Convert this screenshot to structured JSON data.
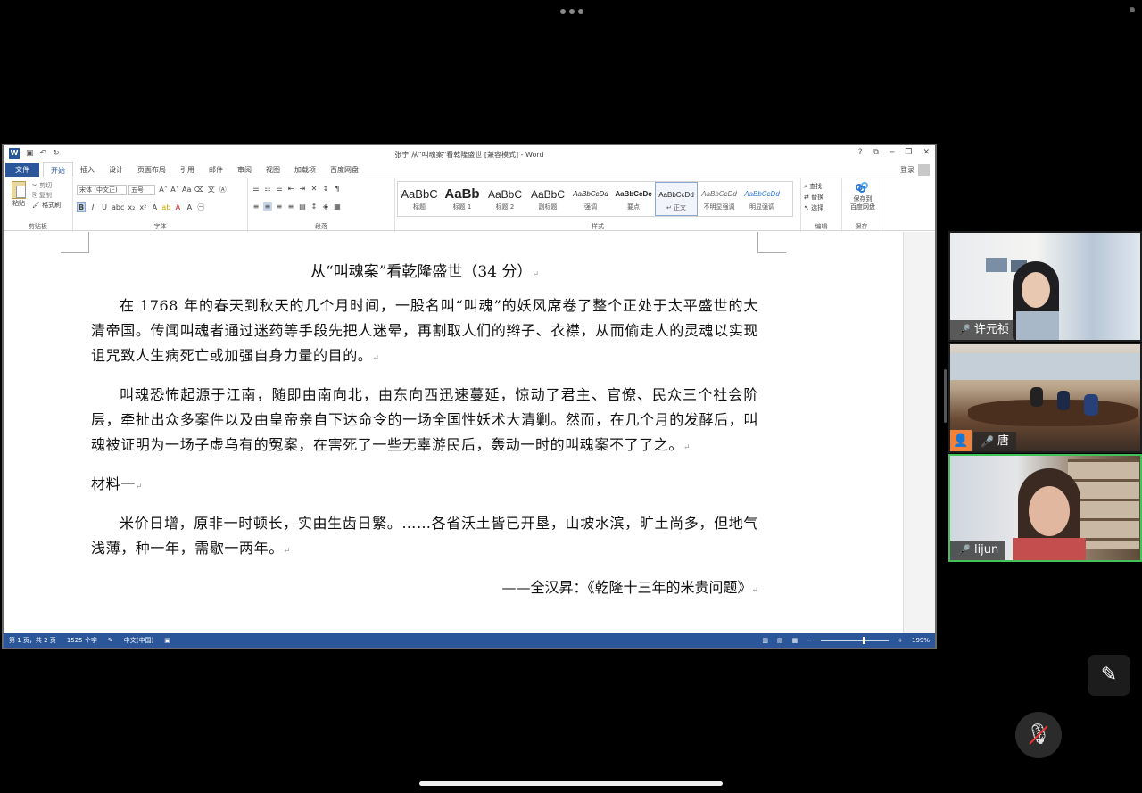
{
  "word": {
    "window_title": "张宁 从\"叫魂案\"看乾隆盛世 [兼容模式] - Word",
    "file_tab": "文件",
    "tabs": [
      "开始",
      "插入",
      "设计",
      "页面布局",
      "引用",
      "邮件",
      "审阅",
      "视图",
      "加载项",
      "百度网盘"
    ],
    "login": "登录",
    "window_controls": [
      "?",
      "⧉",
      "─",
      "❐",
      "✕"
    ],
    "ribbon": {
      "clipboard": {
        "paste": "粘贴",
        "cut": "剪切",
        "copy": "复制",
        "format_painter": "格式刷",
        "label": "剪贴板"
      },
      "font": {
        "name": "宋体 (中文正)",
        "size": "五号",
        "label": "字体"
      },
      "paragraph": {
        "label": "段落"
      },
      "styles": {
        "label": "样式",
        "items": [
          {
            "sample": "AaBbC",
            "name": "标题"
          },
          {
            "sample": "AaBb",
            "name": "标题 1"
          },
          {
            "sample": "AaBbC",
            "name": "标题 2"
          },
          {
            "sample": "AaBbC",
            "name": "副标题"
          },
          {
            "sample": "AaBbCcDd",
            "name": "强调"
          },
          {
            "sample": "AaBbCcDc",
            "name": "要点"
          },
          {
            "sample": "AaBbCcDd",
            "name": "↵ 正文"
          },
          {
            "sample": "AaBbCcDd",
            "name": "不明显强调"
          },
          {
            "sample": "AaBbCcDd",
            "name": "明显强调"
          }
        ]
      },
      "editing": {
        "find": "查找",
        "replace": "替换",
        "select": "选择",
        "label": "编辑"
      },
      "save": {
        "line1": "保存到",
        "line2": "百度网盘",
        "label": "保存"
      }
    },
    "document": {
      "title": "从“叫魂案”看乾隆盛世（34 分）",
      "para1": "在 1768 年的春天到秋天的几个月时间，一股名叫“叫魂”的妖风席卷了整个正处于太平盛世的大清帝国。传闻叫魂者通过迷药等手段先把人迷晕，再割取人们的辫子、衣襟，从而偷走人的灵魂以实现诅咒致人生病死亡或加强自身力量的目的。",
      "para2": "叫魂恐怖起源于江南，随即由南向北，由东向西迅速蔓延，惊动了君主、官僚、民众三个社会阶层，牵扯出众多案件以及由皇帝亲自下达命令的一场全国性妖术大清剿。然而，在几个月的发酵后，叫魂被证明为一场子虚乌有的冤案，在害死了一些无辜游民后，轰动一时的叫魂案不了了之。",
      "heading": "材料一",
      "para3": "米价日增，原非一时顿长，实由生齿日繁。……各省沃土皆已开垦，山坡水滨，旷土尚多，但地气浅薄，种一年，需歇一两年。",
      "source": "——全汉昇：《乾隆十三年的米贵问题》"
    },
    "status": {
      "page": "第 1 页，共 2 页",
      "words": "1525 个字",
      "lang": "中文(中国)",
      "zoom": "199%",
      "zoom_fraction": 0.62
    }
  },
  "participants": [
    {
      "name": "许元祯",
      "mic": "unmuted"
    },
    {
      "name": "唐",
      "mic": "unmuted"
    },
    {
      "name": "lijun",
      "mic": "unmuted"
    }
  ],
  "colors": {
    "word_blue": "#2b579a",
    "active_speaker": "#44c25a"
  }
}
